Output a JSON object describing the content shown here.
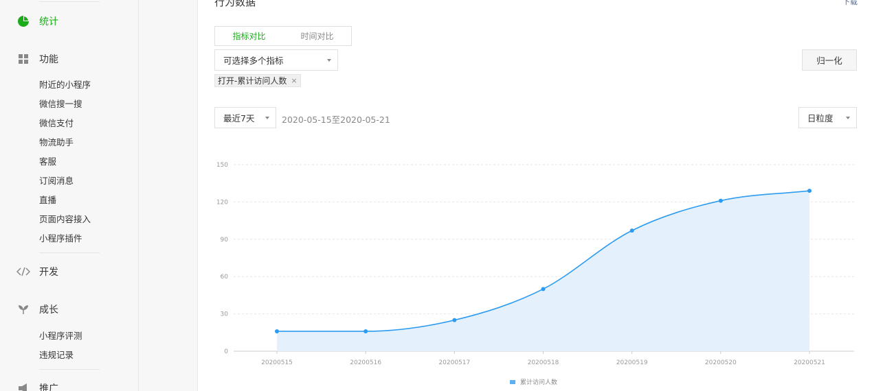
{
  "sidebar": {
    "sections": [
      {
        "label": "统计",
        "icon": "pie-chart-icon",
        "active": true
      },
      {
        "label": "功能",
        "icon": "grid-icon"
      },
      {
        "label": "开发",
        "icon": "code-icon"
      },
      {
        "label": "成长",
        "icon": "sprout-icon"
      },
      {
        "label": "推广",
        "icon": "megaphone-icon"
      }
    ],
    "function_items": [
      "附近的小程序",
      "微信搜一搜",
      "微信支付",
      "物流助手",
      "客服",
      "订阅消息",
      "直播",
      "页面内容接入",
      "小程序插件"
    ],
    "growth_items": [
      "小程序评测",
      "违规记录"
    ]
  },
  "main": {
    "title": "行为数据",
    "download": "下载",
    "tabs": [
      {
        "label": "指标对比",
        "active": true
      },
      {
        "label": "时间对比",
        "active": false
      }
    ],
    "metric_select_placeholder": "可选择多个指标",
    "normalize_button": "归一化",
    "selected_metric_tag": "打开-累计访问人数",
    "tag_close": "×",
    "period_select": "最近7天",
    "date_range": "2020-05-15至2020-05-21",
    "granularity_select": "日粒度"
  },
  "colors": {
    "accent": "#1aad19",
    "line": "#2d9bf0",
    "area": "#e4f1fc"
  },
  "chart_data": {
    "type": "area",
    "x": [
      "20200515",
      "20200516",
      "20200517",
      "20200518",
      "20200519",
      "20200520",
      "20200521"
    ],
    "series": [
      {
        "name": "累计访问人数",
        "values": [
          16,
          16,
          25,
          50,
          97,
          121,
          129
        ]
      }
    ],
    "ylim": [
      0,
      150
    ],
    "yticks": [
      0,
      30,
      60,
      90,
      120,
      150
    ],
    "grid": true,
    "legend_position": "bottom-center"
  }
}
